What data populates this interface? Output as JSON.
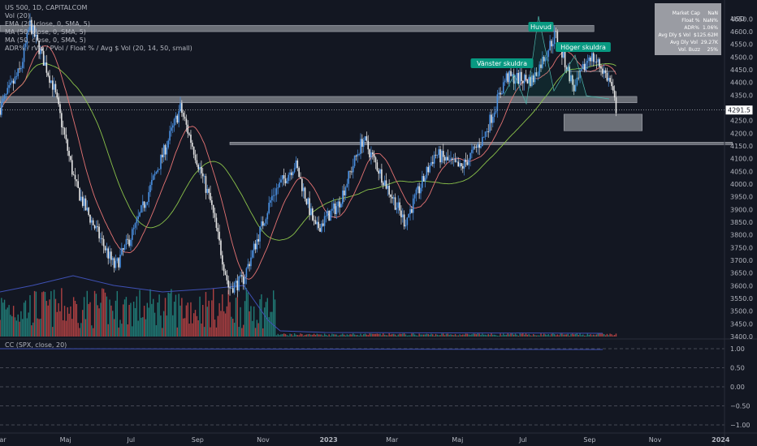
{
  "header": {
    "symbol_line": "US 500, 1D, CAPITALCOM",
    "currency": "USD"
  },
  "indicators": [
    "Vol (20)",
    "EMA (20, close, 0, SMA, 5)",
    "MA (50, close, 0, SMA, 5)",
    "MA (50, close, 0, SMA, 5)",
    "ADR% / rVol / PVol / Float % / Avg $ Vol (20, 14, 50, small)"
  ],
  "stats_table": [
    {
      "label": "Market Cap",
      "value": "NaN"
    },
    {
      "label": "Float %",
      "value": "NaN%"
    },
    {
      "label": "ADR%",
      "value": "1.06%"
    },
    {
      "label": "Avg Dly $ Vol",
      "value": "$125.62M"
    },
    {
      "label": "Avg Dly Vol",
      "value": "29.27K"
    },
    {
      "label": "Vol. Buzz",
      "value": "25%"
    }
  ],
  "pattern_labels": {
    "left_shoulder": "Vänster skuldra",
    "head": "Huvud",
    "right_shoulder": "Höger skuldra"
  },
  "current_price_label": "4291.5",
  "cc_label": "CC (SPX, close, 20)",
  "colors": {
    "background": "#131722",
    "candle": "#4a90e2",
    "candle_dark": "#e6e6e6",
    "ema20": "#e57373",
    "ma50": "#8bc34a",
    "volume_up": "#26a69a",
    "volume_down": "#ef5350",
    "vol_ma": "#3f51b5",
    "zone": "#8a8d94",
    "label_bg": "#089981",
    "price_label_bg": "#ffffff"
  },
  "chart_data": {
    "type": "candlestick",
    "title": "US 500, 1D, CAPITALCOM",
    "y_axis_ticks": [
      3400,
      3450,
      3500,
      3550,
      3600,
      3650,
      3700,
      3750,
      3800,
      3850,
      3900,
      3950,
      4000,
      4050,
      4100,
      4150,
      4200,
      4250,
      4300,
      4350,
      4400,
      4450,
      4500,
      4550,
      4600,
      4650
    ],
    "ylim": [
      3380,
      4690
    ],
    "x_axis_labels": [
      "Mar",
      "Maj",
      "Jul",
      "Sep",
      "Nov",
      "2023",
      "Mar",
      "Maj",
      "Jul",
      "Sep",
      "Nov",
      "2024"
    ],
    "close_path": [
      {
        "date": "2022-03-01",
        "close": 4300
      },
      {
        "date": "2022-03-20",
        "close": 4450
      },
      {
        "date": "2022-03-29",
        "close": 4630
      },
      {
        "date": "2022-04-20",
        "close": 4380
      },
      {
        "date": "2022-05-10",
        "close": 4000
      },
      {
        "date": "2022-05-20",
        "close": 3900
      },
      {
        "date": "2022-06-16",
        "close": 3670
      },
      {
        "date": "2022-07-05",
        "close": 3830
      },
      {
        "date": "2022-08-16",
        "close": 4300
      },
      {
        "date": "2022-09-13",
        "close": 3930
      },
      {
        "date": "2022-09-30",
        "close": 3590
      },
      {
        "date": "2022-10-13",
        "close": 3620
      },
      {
        "date": "2022-11-10",
        "close": 3960
      },
      {
        "date": "2022-12-01",
        "close": 4080
      },
      {
        "date": "2022-12-20",
        "close": 3820
      },
      {
        "date": "2023-01-10",
        "close": 3920
      },
      {
        "date": "2023-02-02",
        "close": 4180
      },
      {
        "date": "2023-03-13",
        "close": 3850
      },
      {
        "date": "2023-04-10",
        "close": 4120
      },
      {
        "date": "2023-05-04",
        "close": 4060
      },
      {
        "date": "2023-05-25",
        "close": 4180
      },
      {
        "date": "2023-06-15",
        "close": 4420
      },
      {
        "date": "2023-07-10",
        "close": 4410
      },
      {
        "date": "2023-07-31",
        "close": 4590
      },
      {
        "date": "2023-08-18",
        "close": 4370
      },
      {
        "date": "2023-09-01",
        "close": 4510
      },
      {
        "date": "2023-09-12",
        "close": 4460
      },
      {
        "date": "2023-09-20",
        "close": 4400
      },
      {
        "date": "2023-09-26",
        "close": 4291.5
      }
    ],
    "zones": [
      {
        "name": "top-resistance",
        "price_low": 4600,
        "price_high": 4625,
        "from": "2022-03-01",
        "to": "2023-09-05"
      },
      {
        "name": "neckline-zone",
        "price_low": 4320,
        "price_high": 4345,
        "from": "2022-03-01",
        "to": "2023-10-15"
      },
      {
        "name": "demand-box",
        "price_low": 4210,
        "price_high": 4275,
        "from": "2023-08-08",
        "to": "2023-10-20"
      },
      {
        "name": "support-line",
        "price_low": 4155,
        "price_high": 4165,
        "from": "2022-10-01",
        "to": "2024-01-12"
      }
    ],
    "cc_axis_ticks": [
      1.0,
      0.5,
      0.0,
      -0.5,
      -1.0
    ],
    "legend_position": "top-left"
  }
}
